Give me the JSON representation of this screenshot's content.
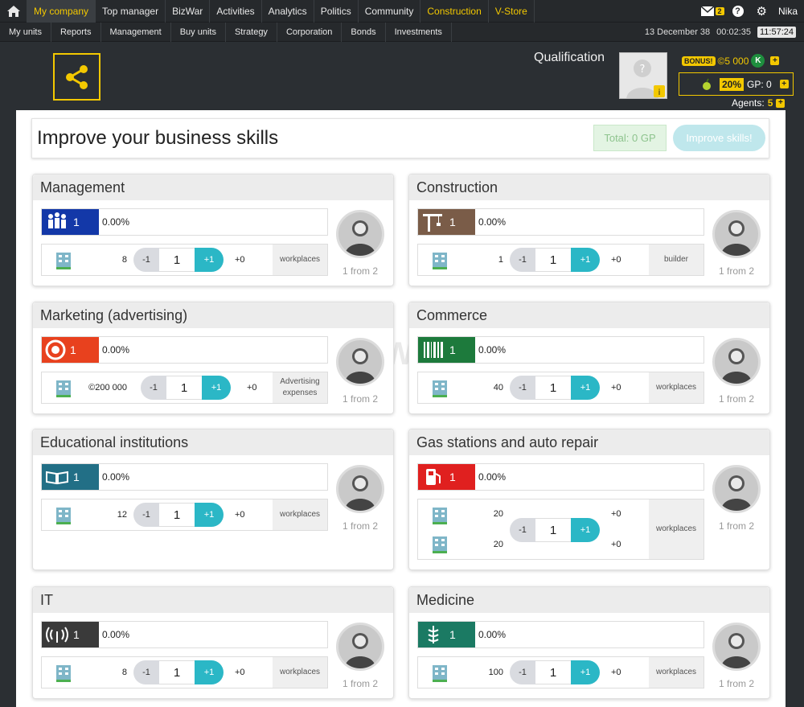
{
  "topnav": {
    "items": [
      "My company",
      "Top manager",
      "BizWar",
      "Activities",
      "Analytics",
      "Politics",
      "Community",
      "Construction",
      "V-Store"
    ],
    "mail_count": "2",
    "user": "Nika"
  },
  "subnav": {
    "items": [
      "My units",
      "Reports",
      "Management",
      "Buy units",
      "Strategy",
      "Corporation",
      "Bonds",
      "Investments"
    ],
    "date": "13 December 38",
    "time_elapsed": "00:02:35",
    "clock": "11:57:24"
  },
  "header": {
    "qualification": "Qualification",
    "bonus_label": "BONUS!",
    "bonus_amount": "©5 000",
    "bonus_k": "K",
    "gp_percent": "20%",
    "gp_label": "GP: 0",
    "agents_label": "Agents:",
    "agents_value": "5"
  },
  "page": {
    "title": "Improve your business skills",
    "total": "Total: 0 GP",
    "improve_button": "Improve skills!"
  },
  "skills": [
    {
      "name": "Management",
      "level": "1",
      "pct": "0.00%",
      "qty": "8",
      "value": "1",
      "minus": "-1",
      "plus": "+1",
      "inc": "+0",
      "unit": "workplaces",
      "from": "1 from 2",
      "color": "#1338a8",
      "icon": "people-icon"
    },
    {
      "name": "Construction",
      "level": "1",
      "pct": "0.00%",
      "qty": "1",
      "value": "1",
      "minus": "-1",
      "plus": "+1",
      "inc": "+0",
      "unit": "builder",
      "from": "1 from 2",
      "color": "#7a5c48",
      "icon": "crane-icon"
    },
    {
      "name": "Marketing (advertising)",
      "level": "1",
      "pct": "0.00%",
      "qty": "©200 000",
      "value": "1",
      "minus": "-1",
      "plus": "+1",
      "inc": "+0",
      "unit": "Advertising expenses",
      "from": "1 from 2",
      "color": "#e8411e",
      "icon": "target-icon"
    },
    {
      "name": "Commerce",
      "level": "1",
      "pct": "0.00%",
      "qty": "40",
      "value": "1",
      "minus": "-1",
      "plus": "+1",
      "inc": "+0",
      "unit": "workplaces",
      "from": "1 from 2",
      "color": "#1d7a3c",
      "icon": "barcode-icon"
    },
    {
      "name": "Educational institutions",
      "level": "1",
      "pct": "0.00%",
      "qty": "12",
      "value": "1",
      "minus": "-1",
      "plus": "+1",
      "inc": "+0",
      "unit": "workplaces",
      "from": "1 from 2",
      "color": "#226f86",
      "icon": "book-icon"
    },
    {
      "name": "Gas stations and auto repair",
      "level": "1",
      "pct": "0.00%",
      "qty": "20",
      "qty2": "20",
      "value": "1",
      "minus": "-1",
      "plus": "+1",
      "inc": "+0",
      "inc2": "+0",
      "unit": "workplaces",
      "from": "1 from 2",
      "color": "#e0201f",
      "icon": "fuel-icon"
    },
    {
      "name": "IT",
      "level": "1",
      "pct": "0.00%",
      "qty": "8",
      "value": "1",
      "minus": "-1",
      "plus": "+1",
      "inc": "+0",
      "unit": "workplaces",
      "from": "1 from 2",
      "color": "#3a3a3a",
      "icon": "signal-icon"
    },
    {
      "name": "Medicine",
      "level": "1",
      "pct": "0.00%",
      "qty": "100",
      "value": "1",
      "minus": "-1",
      "plus": "+1",
      "inc": "+0",
      "unit": "workplaces",
      "from": "1 from 2",
      "color": "#1b7a63",
      "icon": "caduceus-icon"
    }
  ],
  "watermark": "CRYPTOWEEK.COM"
}
